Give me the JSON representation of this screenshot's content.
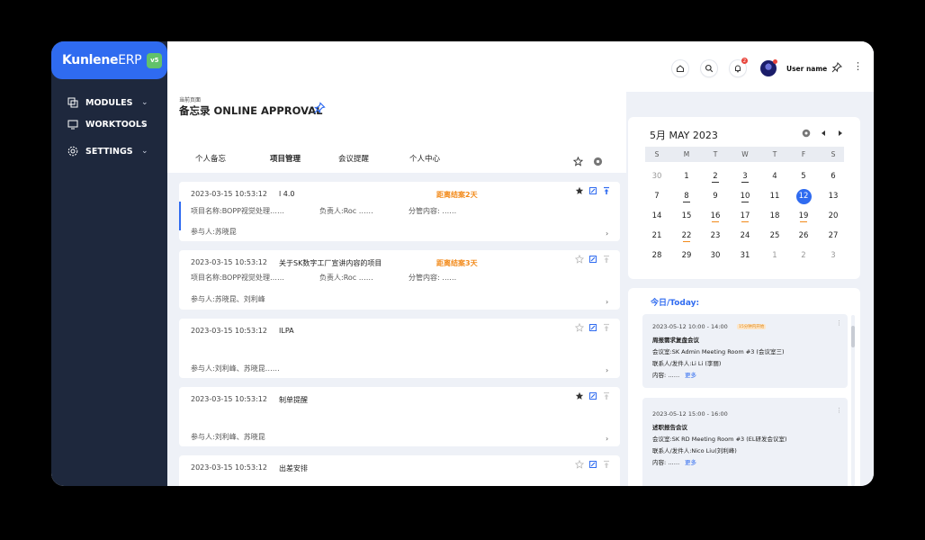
{
  "brand": {
    "name_bold": "Kunlene",
    "name_light": "ERP",
    "version": "v5",
    "color": "#2f6bf0"
  },
  "sidebar": {
    "items": [
      {
        "label": "MODULES",
        "icon": "modules-icon"
      },
      {
        "label": "WORKTOOLS",
        "icon": "monitor-icon"
      },
      {
        "label": "SETTINGS",
        "icon": "gear-icon"
      }
    ]
  },
  "topbar": {
    "username": "User name",
    "notification_count": "2"
  },
  "page": {
    "crumb": "当前页面",
    "title": "备忘录 ONLINE APPROVAL"
  },
  "tabs": [
    {
      "label": "个人备忘",
      "active": false
    },
    {
      "label": "项目管理",
      "active": true
    },
    {
      "label": "会议提醒",
      "active": false
    },
    {
      "label": "个人中心",
      "active": false
    }
  ],
  "memos": [
    {
      "date": "2023-03-15 10:53:12",
      "title": "l 4.0",
      "due": "距离结案2天",
      "project": "项目名称:BOPP视觉处理……",
      "owner": "负责人:Roc ……",
      "content": "分管内容: ……",
      "participants": "参与人:苏晓昆",
      "starred": true,
      "pinned": true
    },
    {
      "date": "2023-03-15 10:53:12",
      "title": "关于SK数字工厂宣讲内容的项目",
      "due": "距离结案3天",
      "project": "项目名称:BOPP视觉处理……",
      "owner": "负责人:Roc ……",
      "content": "分管内容: ……",
      "participants": "参与人:苏晓昆、刘利峰",
      "starred": false,
      "pinned": false
    },
    {
      "date": "2023-03-15 10:53:12",
      "title": "ILPA",
      "due": "",
      "project": "",
      "owner": "",
      "content": "",
      "participants": "参与人:刘利峰、苏晓昆……",
      "starred": false,
      "pinned": false
    },
    {
      "date": "2023-03-15 10:53:12",
      "title": "制单提醒",
      "due": "",
      "project": "",
      "owner": "",
      "content": "",
      "participants": "参与人:刘利峰、苏晓昆",
      "starred": true,
      "pinned": false
    },
    {
      "date": "2023-03-15 10:53:12",
      "title": "出差安排",
      "due": "",
      "project": "",
      "owner": "",
      "content": "",
      "participants": "",
      "starred": false,
      "pinned": false
    }
  ],
  "calendar": {
    "title": "5月 MAY 2023",
    "weekdays": [
      "S",
      "M",
      "T",
      "W",
      "T",
      "F",
      "S"
    ],
    "weeks": [
      [
        {
          "d": "30",
          "m": 1
        },
        {
          "d": "1"
        },
        {
          "d": "2",
          "u": "#333"
        },
        {
          "d": "3",
          "u": "#333"
        },
        {
          "d": "4"
        },
        {
          "d": "5"
        },
        {
          "d": "6"
        }
      ],
      [
        {
          "d": "7"
        },
        {
          "d": "8",
          "u": "#333"
        },
        {
          "d": "9"
        },
        {
          "d": "10",
          "u": "#333"
        },
        {
          "d": "11"
        },
        {
          "d": "12",
          "t": 1
        },
        {
          "d": "13"
        }
      ],
      [
        {
          "d": "14"
        },
        {
          "d": "15"
        },
        {
          "d": "16",
          "u": "#f28a1a"
        },
        {
          "d": "17",
          "u": "#f28a1a"
        },
        {
          "d": "18"
        },
        {
          "d": "19",
          "u": "#f28a1a"
        },
        {
          "d": "20"
        }
      ],
      [
        {
          "d": "21"
        },
        {
          "d": "22",
          "u": "#f28a1a"
        },
        {
          "d": "23"
        },
        {
          "d": "24"
        },
        {
          "d": "25"
        },
        {
          "d": "26"
        },
        {
          "d": "27"
        }
      ],
      [
        {
          "d": "28"
        },
        {
          "d": "29"
        },
        {
          "d": "30"
        },
        {
          "d": "31"
        },
        {
          "d": "1",
          "m": 1
        },
        {
          "d": "2",
          "m": 1
        },
        {
          "d": "3",
          "m": 1
        }
      ]
    ]
  },
  "today": {
    "title": "今日/Today:",
    "events": [
      {
        "time": "2023-05-12    10:00 - 14:00",
        "tag": "15分钟内开始",
        "title": "周报需求复盘会议",
        "room": "会议室:SK Admin Meeting Room #3 (会议室三)",
        "contact": "联系人/发件人:Li Li (李丽)",
        "content": "内容: ……",
        "more": "更多"
      },
      {
        "time": "2023-05-12    15:00 - 16:00",
        "tag": "",
        "title": "述职报告会议",
        "room": "会议室:SK  RD Meeting Room #3 (EL研发会议室)",
        "contact": "联系人/发件人:Nico Liu(刘利峰)",
        "content": "内容: ……",
        "more": "更多"
      }
    ]
  }
}
